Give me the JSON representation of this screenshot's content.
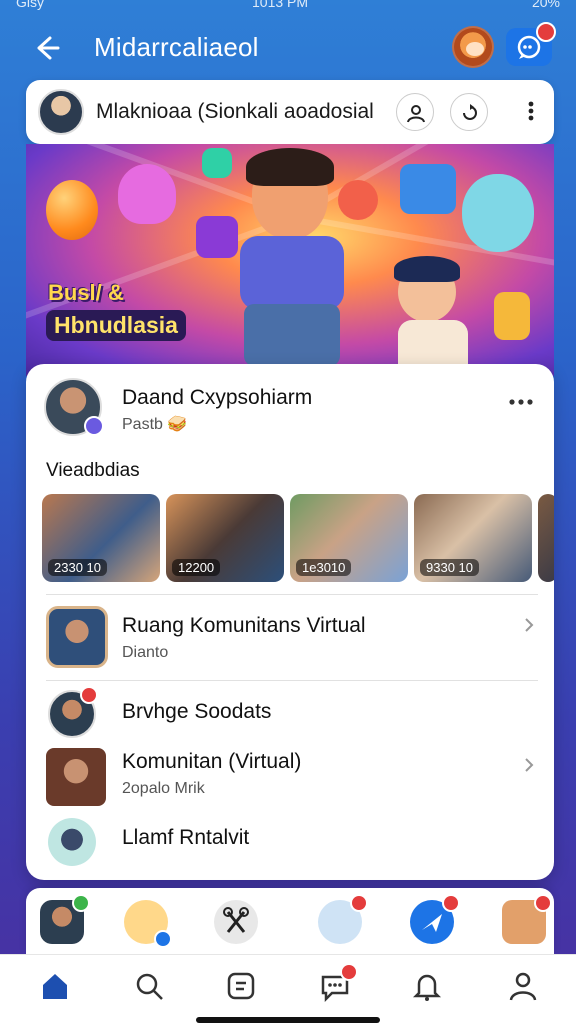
{
  "status_bar": {
    "carrier": "Glsy",
    "time": "1013 PM",
    "battery": "20%"
  },
  "header": {
    "title": "Midarrcaliaeol",
    "back_icon": "back-arrow-icon",
    "message_icon": "chat-bubble-icon"
  },
  "profile": {
    "name": "Mlaknioaa (Sionkali aoadosial",
    "follow_icon": "person-icon",
    "share_icon": "repost-icon",
    "more_icon": "more-vertical-icon"
  },
  "banner": {
    "line1": "Busl/ &",
    "line2": "Hbnudlasia"
  },
  "post": {
    "author": "Daand Cxypsohiarm",
    "subtitle": "Pastb 🥪"
  },
  "videos": {
    "title": "Vieadbdias",
    "items": [
      {
        "label": "2330 10"
      },
      {
        "label": "12200"
      },
      {
        "label": "1e3010"
      },
      {
        "label": "9330 10"
      }
    ]
  },
  "list": [
    {
      "title": "Ruang Komunitans Virtual",
      "subtitle": "Dianto"
    },
    {
      "title": "Brvhge Soodats",
      "subtitle": ""
    },
    {
      "title": "Komunitan (Virtual)",
      "subtitle": "2opalo Mrik"
    },
    {
      "title": "Llamf Rntalvit",
      "subtitle": ""
    }
  ],
  "colors": {
    "accent": "#1d74e6",
    "badge": "#e43c3c",
    "nav_active": "#1d4fb0"
  },
  "nav": [
    "home-icon",
    "search-icon",
    "compose-icon",
    "messages-icon",
    "notifications-icon",
    "profile-icon"
  ]
}
